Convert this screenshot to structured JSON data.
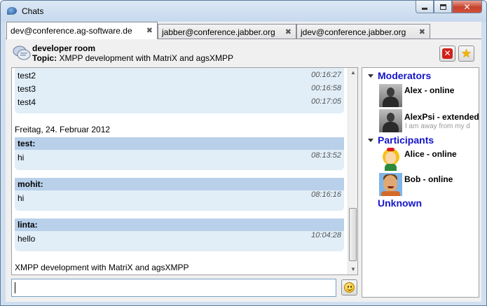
{
  "window": {
    "title": "Chats"
  },
  "tabs": [
    {
      "label": "dev@conference.ag-software.de",
      "active": true
    },
    {
      "label": "jabber@conference.jabber.org",
      "active": false
    },
    {
      "label": "jdev@conference.jabber.org",
      "active": false
    }
  ],
  "room": {
    "name": "developer room",
    "topic_label": "Topic:",
    "topic": "XMPP development with MatriX and agsXMPP"
  },
  "messages": {
    "top_block": [
      {
        "text": "test2",
        "time": "00:16:27"
      },
      {
        "text": "test3",
        "time": "00:16:58"
      },
      {
        "text": "test4",
        "time": "00:17:05"
      }
    ],
    "date_separator": "Freitag, 24. Februar 2012",
    "blocks": [
      {
        "sender": "test:",
        "text": "hi",
        "time": "08:13:52"
      },
      {
        "sender": "mohit:",
        "text": "hi",
        "time": "08:16:16"
      },
      {
        "sender": "linta:",
        "text": "hello",
        "time": "10:04:28"
      }
    ],
    "subject_line": "XMPP development with MatriX and agsXMPP"
  },
  "input": {
    "value": ""
  },
  "roster": {
    "groups": [
      {
        "label": "Moderators",
        "contacts": [
          {
            "name": "Alex",
            "status": "online",
            "status_message": ""
          },
          {
            "name": "AlexPsi",
            "status": "extended",
            "status_message": "I am away from my d"
          }
        ]
      },
      {
        "label": "Participants",
        "contacts": [
          {
            "name": "Alice",
            "status": "online",
            "status_message": ""
          },
          {
            "name": "Bob",
            "status": "online",
            "status_message": ""
          }
        ]
      },
      {
        "label": "Unknown",
        "contacts": []
      }
    ]
  },
  "colors": {
    "group_label": "#1414c8",
    "message_bubble": "#e1eef8",
    "sender_bar": "#b9d0ea"
  }
}
